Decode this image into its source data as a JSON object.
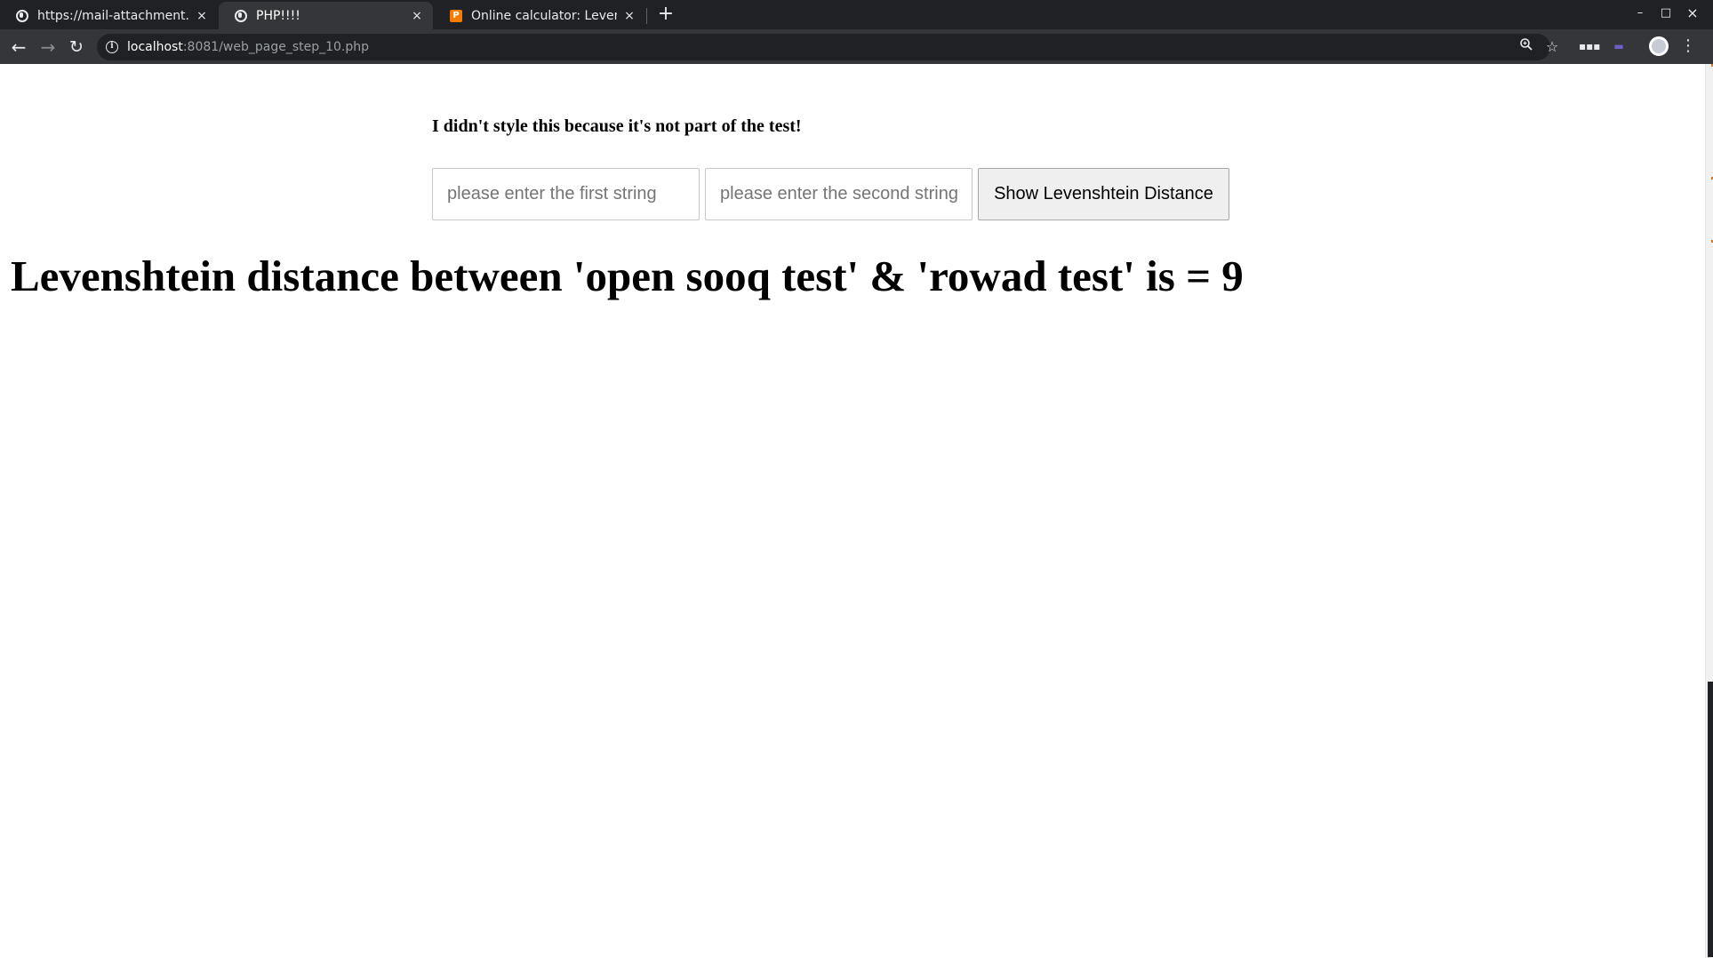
{
  "browser": {
    "tabs": [
      {
        "title": "https://mail-attachment.g",
        "close": "×",
        "favicon": "globe-icon"
      },
      {
        "title": "PHP!!!!",
        "close": "×",
        "favicon": "globe-icon"
      },
      {
        "title": "Online calculator: Levensh",
        "close": "×",
        "favicon": "planetcalc-icon"
      }
    ],
    "new_tab": "+",
    "window_controls": {
      "minimize": "–",
      "maximize": "□",
      "close": "×"
    },
    "address": {
      "host": "localhost",
      "rest": ":8081/web_page_step_10.php"
    }
  },
  "page": {
    "note": "I didn't style this because it's not part of the test!",
    "first_input": {
      "placeholder": "please enter the first string",
      "value": ""
    },
    "second_input": {
      "placeholder": "please enter the second string",
      "value": ""
    },
    "submit_label": "Show Levenshtein Distance",
    "result": "Levenshtein distance between 'open sooq test' & 'rowad test' is = 9"
  },
  "colors": {
    "tabstrip": "#202124",
    "toolbar": "#35363a",
    "omnibox": "#202124",
    "page_background": "#ffffff",
    "button_background": "#efefef"
  }
}
